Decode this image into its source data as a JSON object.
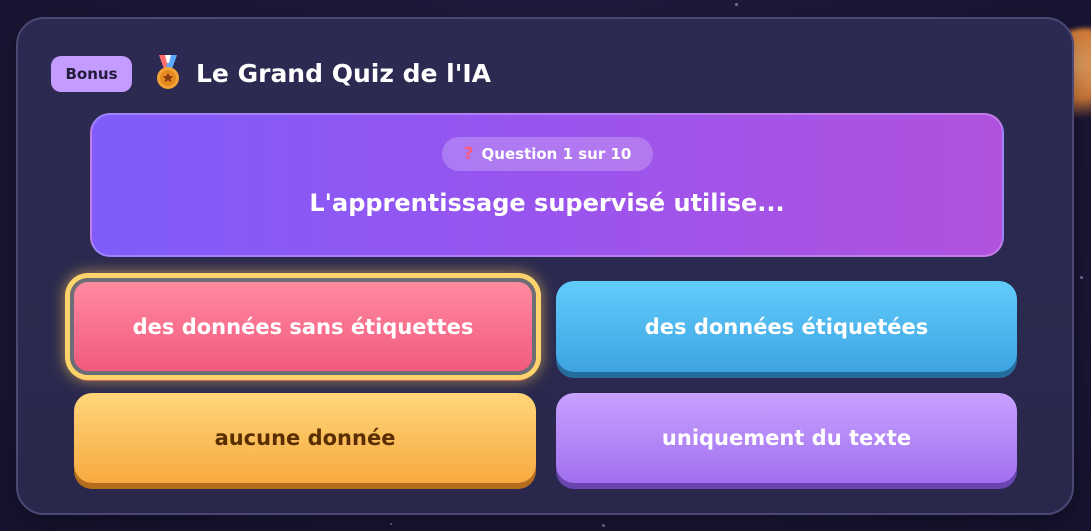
{
  "header": {
    "badge": "Bonus",
    "icon": "medal-icon",
    "title": "Le Grand Quiz de l'IA"
  },
  "question": {
    "counter_icon": "question-mark-icon",
    "counter_symbol": "?",
    "counter": "Question 1 sur 10",
    "text": "L'apprentissage supervisé utilise..."
  },
  "answers": [
    {
      "label": "des données sans étiquettes",
      "color": "#f25a7e",
      "selected": true
    },
    {
      "label": "des données étiquetées",
      "color": "#3da4e2",
      "selected": false
    },
    {
      "label": "aucune donnée",
      "color": "#f7aa40",
      "selected": false
    },
    {
      "label": "uniquement du texte",
      "color": "#a16fef",
      "selected": false
    }
  ],
  "colors": {
    "selection_outline": "#ffd36b",
    "question_card_start": "#7f5cfb",
    "question_card_end": "#b052de",
    "badge": "#c49bff"
  }
}
